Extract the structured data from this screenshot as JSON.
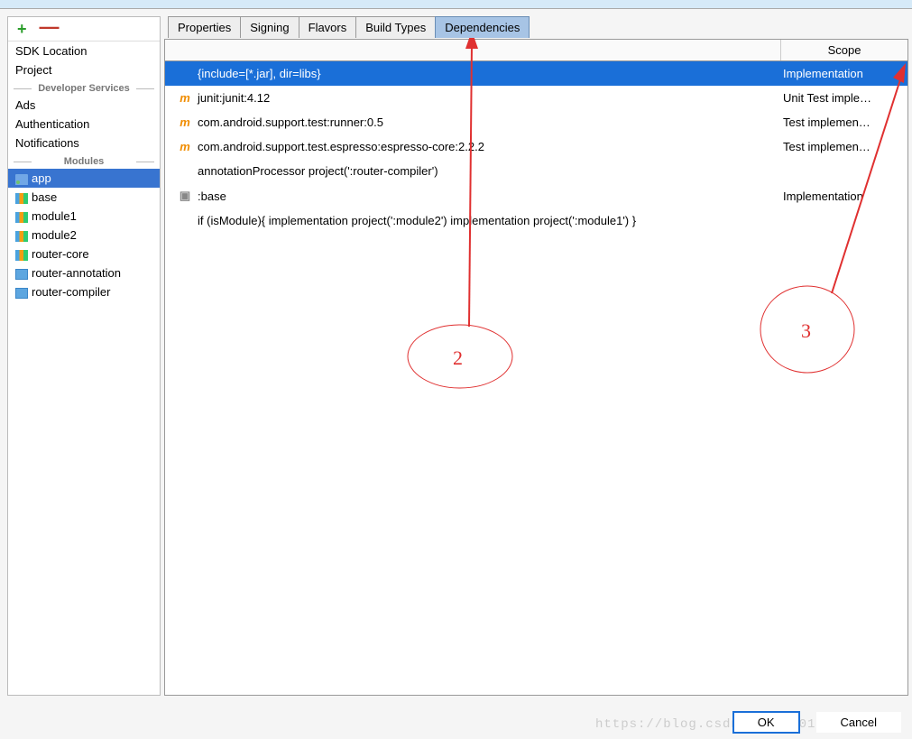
{
  "sidebar": {
    "items_top": [
      {
        "label": "SDK Location"
      },
      {
        "label": "Project"
      }
    ],
    "divider1": "Developer Services",
    "items_dev": [
      {
        "label": "Ads"
      },
      {
        "label": "Authentication"
      },
      {
        "label": "Notifications"
      }
    ],
    "divider2": "Modules",
    "modules": [
      {
        "label": "app",
        "icon": "folder",
        "selected": true
      },
      {
        "label": "base",
        "icon": "chart"
      },
      {
        "label": "module1",
        "icon": "chart"
      },
      {
        "label": "module2",
        "icon": "chart"
      },
      {
        "label": "router-core",
        "icon": "chart"
      },
      {
        "label": "router-annotation",
        "icon": "folderblue"
      },
      {
        "label": "router-compiler",
        "icon": "folderblue"
      }
    ]
  },
  "tabs": [
    {
      "label": "Properties"
    },
    {
      "label": "Signing"
    },
    {
      "label": "Flavors"
    },
    {
      "label": "Build Types"
    },
    {
      "label": "Dependencies",
      "active": true
    }
  ],
  "table": {
    "header_scope": "Scope",
    "rows": [
      {
        "icon": "",
        "text": "{include=[*.jar], dir=libs}",
        "scope": "Implementation",
        "selected": true
      },
      {
        "icon": "m",
        "text": "junit:junit:4.12",
        "scope": "Unit Test imple…"
      },
      {
        "icon": "m",
        "text": "com.android.support.test:runner:0.5",
        "scope": "Test implemen…"
      },
      {
        "icon": "m",
        "text": "com.android.support.test.espresso:espresso-core:2.2.2",
        "scope": "Test implemen…"
      },
      {
        "icon": "",
        "text": "annotationProcessor project(':router-compiler')",
        "scope": ""
      },
      {
        "icon": "folder",
        "text": ":base",
        "scope": "Implementation"
      },
      {
        "icon": "",
        "text": "if (isModule){        implementation project(':module2')        implementation project(':module1')    }",
        "scope": ""
      }
    ]
  },
  "buttons": {
    "ok": "OK",
    "cancel": "Cancel"
  },
  "watermark": "https://blog.csdn.net/u0014133419",
  "annotations": {
    "label2": "2",
    "label3": "3"
  }
}
